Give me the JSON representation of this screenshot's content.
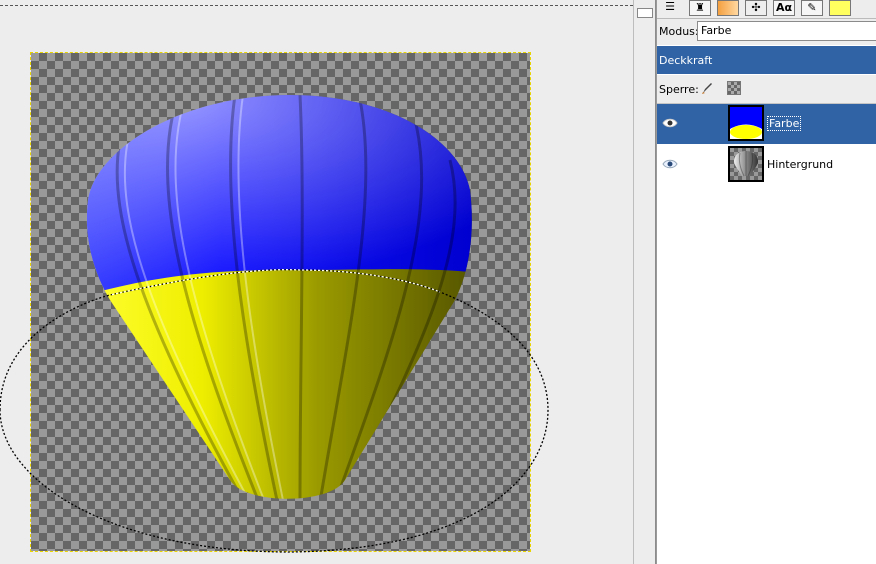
{
  "layers_panel": {
    "mode_label": "Modus:",
    "mode_value": "Farbe",
    "opacity_label": "Deckkraft",
    "lock_label": "Sperre:",
    "tab_text_tool": "Aα",
    "layers": [
      {
        "name": "Farbe",
        "visible": true,
        "selected": true
      },
      {
        "name": "Hintergrund",
        "visible": true,
        "selected": false
      }
    ]
  },
  "colors": {
    "selection_highlight": "#2f63a5",
    "balloon_top": "#0000ff",
    "balloon_bottom": "#ffff00",
    "canvas_border": "#e8d400"
  }
}
